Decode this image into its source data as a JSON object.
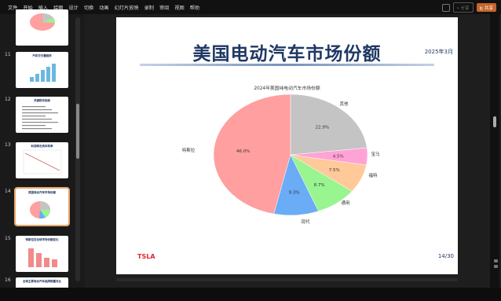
{
  "menu": {
    "items": [
      "文件",
      "开始",
      "插入",
      "绘图",
      "设计",
      "切换",
      "动画",
      "幻灯片放映",
      "录制",
      "审阅",
      "视图",
      "帮助"
    ]
  },
  "toolbar": {
    "share_disabled_label": "• 分享",
    "share_label": "⊵ 共享"
  },
  "thumbnails": [
    {
      "num": "",
      "title": "",
      "kind": "pie-small"
    },
    {
      "num": "11",
      "title": "汽车交付量趋势",
      "kind": "bars"
    },
    {
      "num": "12",
      "title": "关键财务指标",
      "kind": "text"
    },
    {
      "num": "13",
      "title": "利润率及资本效率",
      "kind": "line"
    },
    {
      "num": "14",
      "title": "美国电动汽车市场份额",
      "kind": "pie"
    },
    {
      "num": "15",
      "title": "特斯拉在全球市场份额变化",
      "kind": "bars-red"
    },
    {
      "num": "16",
      "title": "全球主要电动汽车品牌销量对比",
      "kind": "title-only"
    }
  ],
  "slide": {
    "title": "美国电动汽车市场份额",
    "date": "2025年3月",
    "footer_logo": "TSLA",
    "page": "14/30"
  },
  "chart_data": {
    "type": "pie",
    "title": "2024年美国纯电动汽车市场份额",
    "slices": [
      {
        "label": "特斯拉",
        "value": 46.0,
        "pct_label": "46.0%",
        "color": "#ff9f9f"
      },
      {
        "label": "现代",
        "value": 9.3,
        "pct_label": "9.3%",
        "color": "#6aacf5"
      },
      {
        "label": "通用",
        "value": 8.7,
        "pct_label": "8.7%",
        "color": "#98f58f"
      },
      {
        "label": "福特",
        "value": 7.5,
        "pct_label": "7.5%",
        "color": "#ffc999"
      },
      {
        "label": "宝马",
        "value": 4.5,
        "pct_label": "4.5%",
        "color": "#ffa3d6"
      },
      {
        "label": "其他",
        "value": 22.9,
        "pct_label": "22.9%",
        "color": "#c4c4c4"
      }
    ]
  }
}
